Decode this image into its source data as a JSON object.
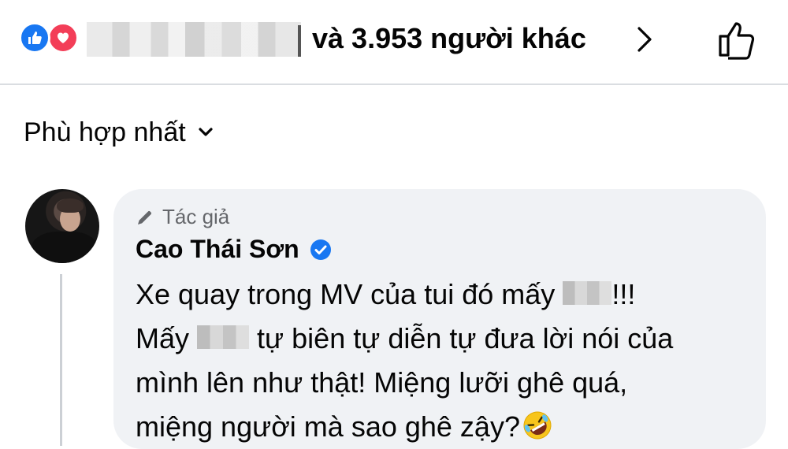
{
  "reactions": {
    "icons": [
      "like-icon",
      "love-icon"
    ],
    "summary_text": "và 3.953 người khác",
    "colors": {
      "like": "#1877f2",
      "love": "#f33e58"
    }
  },
  "sort": {
    "label": "Phù hợp nhất"
  },
  "comment": {
    "author_badge": "Tác giả",
    "commenter_name": "Cao Thái Sơn",
    "verified": true,
    "lines": [
      {
        "before": "Xe quay trong MV của tui đó mấy",
        "after": "!!!"
      },
      {
        "before": "Mấy",
        "after": "tự biên tự diễn tự đưa lời nói của"
      },
      {
        "text": "mình lên như thật! Miệng lưỡi ghê quá,"
      },
      {
        "text": "miệng người mà sao ghê zậy?",
        "emoji": "rofl-emoji-icon"
      }
    ]
  }
}
